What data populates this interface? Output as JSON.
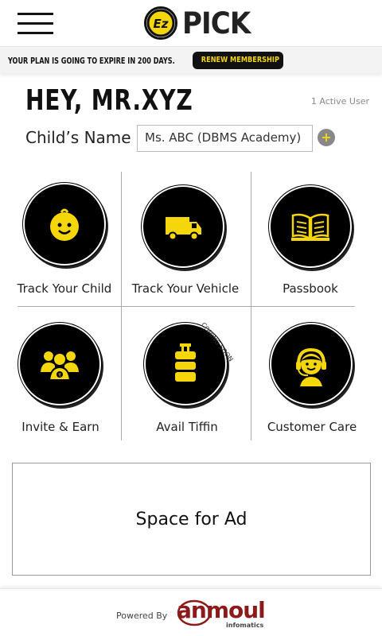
{
  "header": {
    "menu_icon": "hamburger-menu-icon",
    "logo_text": "PICK",
    "logo_mark_text": "Ez"
  },
  "banner": {
    "text": "YOUR PLAN IS GOING TO EXPIRE IN 200 DAYS.",
    "renew_label": "RENEW MEMBERSHIP"
  },
  "greeting": {
    "text": "HEY, MR.XYZ",
    "active_users": "1 Active User"
  },
  "child": {
    "label": "Child’s Name",
    "selected": "Ms. ABC (DBMS Academy)",
    "add_label": "+"
  },
  "tiles": [
    {
      "label": "Track Your Child",
      "icon": "child-face-icon"
    },
    {
      "label": "Track Your Vehicle",
      "icon": "van-icon"
    },
    {
      "label": "Passbook",
      "icon": "open-book-icon"
    },
    {
      "label": "Invite & Earn",
      "icon": "invite-people-icon"
    },
    {
      "label": "Avail Tiffin",
      "icon": "tiffin-box-icon",
      "badge": "COMING SOON"
    },
    {
      "label": "Customer Care",
      "icon": "headset-agent-icon"
    }
  ],
  "ad": {
    "text": "Space for Ad"
  },
  "footer": {
    "powered_by": "Powered By",
    "brand": "anmoul",
    "brand_sub": "infomatics"
  },
  "colors": {
    "accent_yellow": "#f5d60b",
    "dark": "#111111",
    "brand_red": "#8b1a1a"
  }
}
